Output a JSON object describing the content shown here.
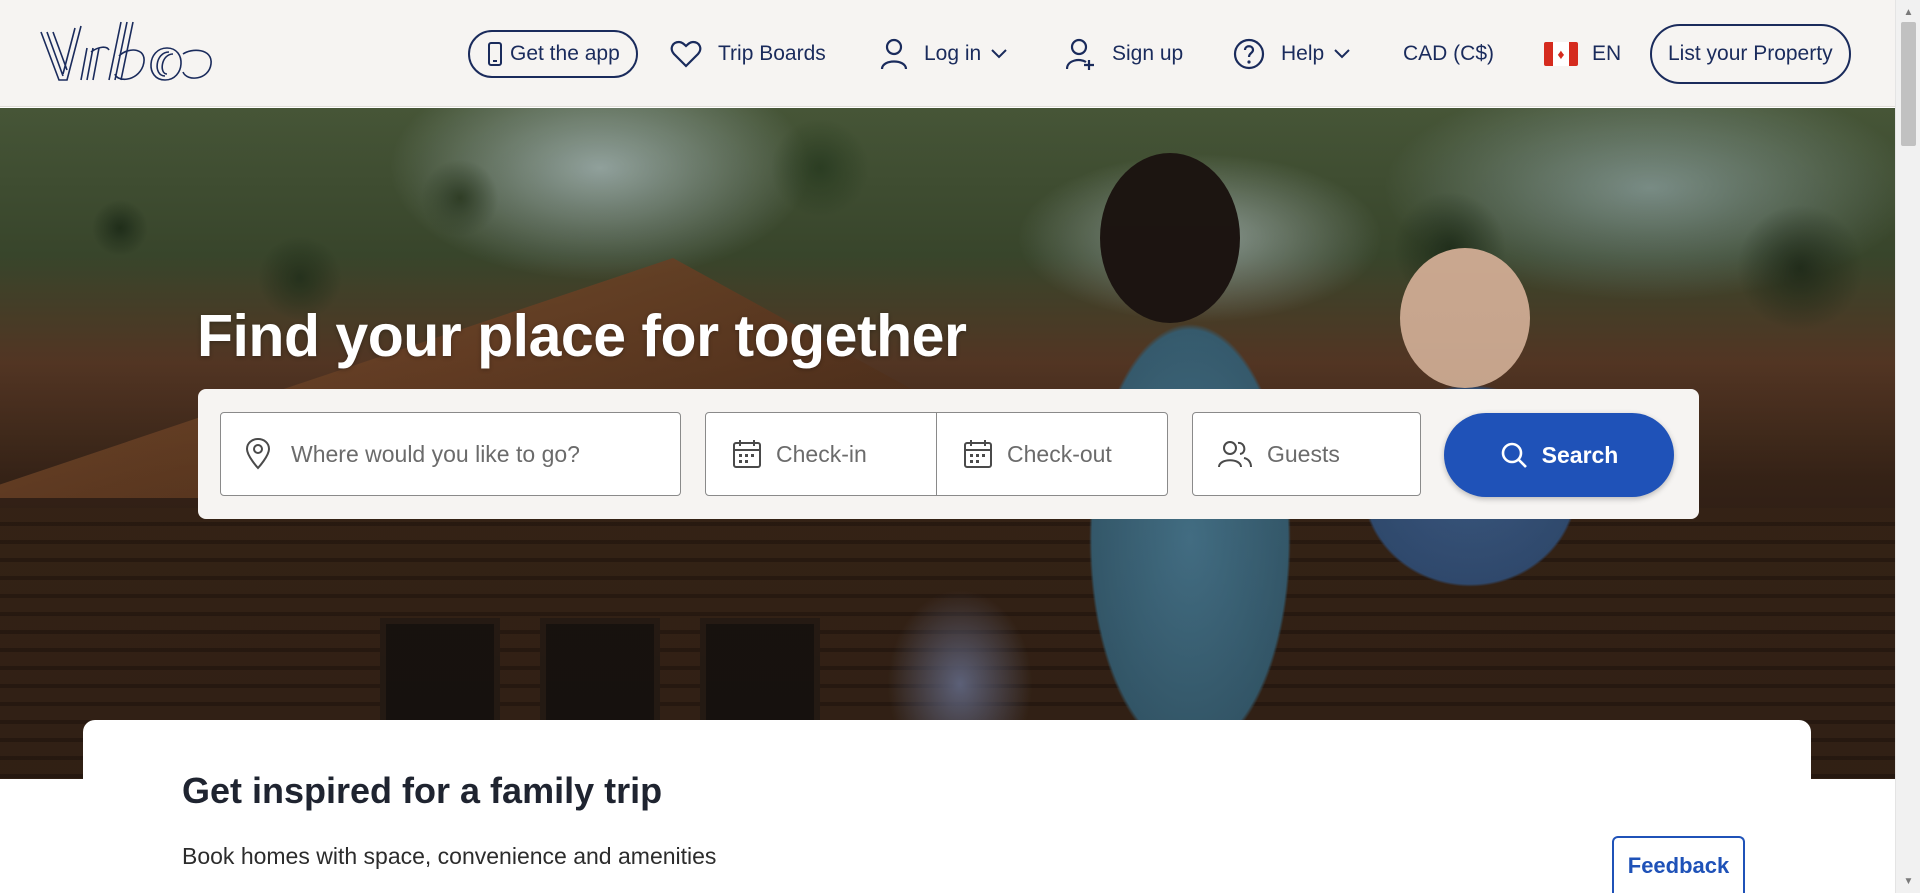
{
  "header": {
    "logo_text": "Vrbo",
    "get_app_label": "Get the app",
    "trip_boards_label": "Trip Boards",
    "login_label": "Log in",
    "signup_label": "Sign up",
    "help_label": "Help",
    "currency_label": "CAD (C$)",
    "language_label": "EN",
    "list_property_label": "List your Property"
  },
  "hero": {
    "headline": "Find your place for together"
  },
  "search": {
    "destination_placeholder": "Where would you like to go?",
    "checkin_placeholder": "Check-in",
    "checkout_placeholder": "Check-out",
    "guests_placeholder": "Guests",
    "button_label": "Search"
  },
  "section": {
    "title": "Get inspired for a family trip",
    "subtitle": "Book homes with space, convenience and amenities"
  },
  "feedback_label": "Feedback",
  "icons": {
    "logo": "vrbo-logo",
    "phone": "phone-icon",
    "heart": "heart-icon",
    "user": "user-icon",
    "add_user": "user-plus-icon",
    "help": "question-circle-icon",
    "chevron": "chevron-down-icon",
    "flag": "canada-flag-icon",
    "pin": "map-pin-icon",
    "calendar": "calendar-icon",
    "guests": "users-icon",
    "search": "search-icon"
  },
  "colors": {
    "brand_navy": "#1a2b5c",
    "search_blue": "#1f52b8",
    "header_bg": "#f6f4f2"
  }
}
